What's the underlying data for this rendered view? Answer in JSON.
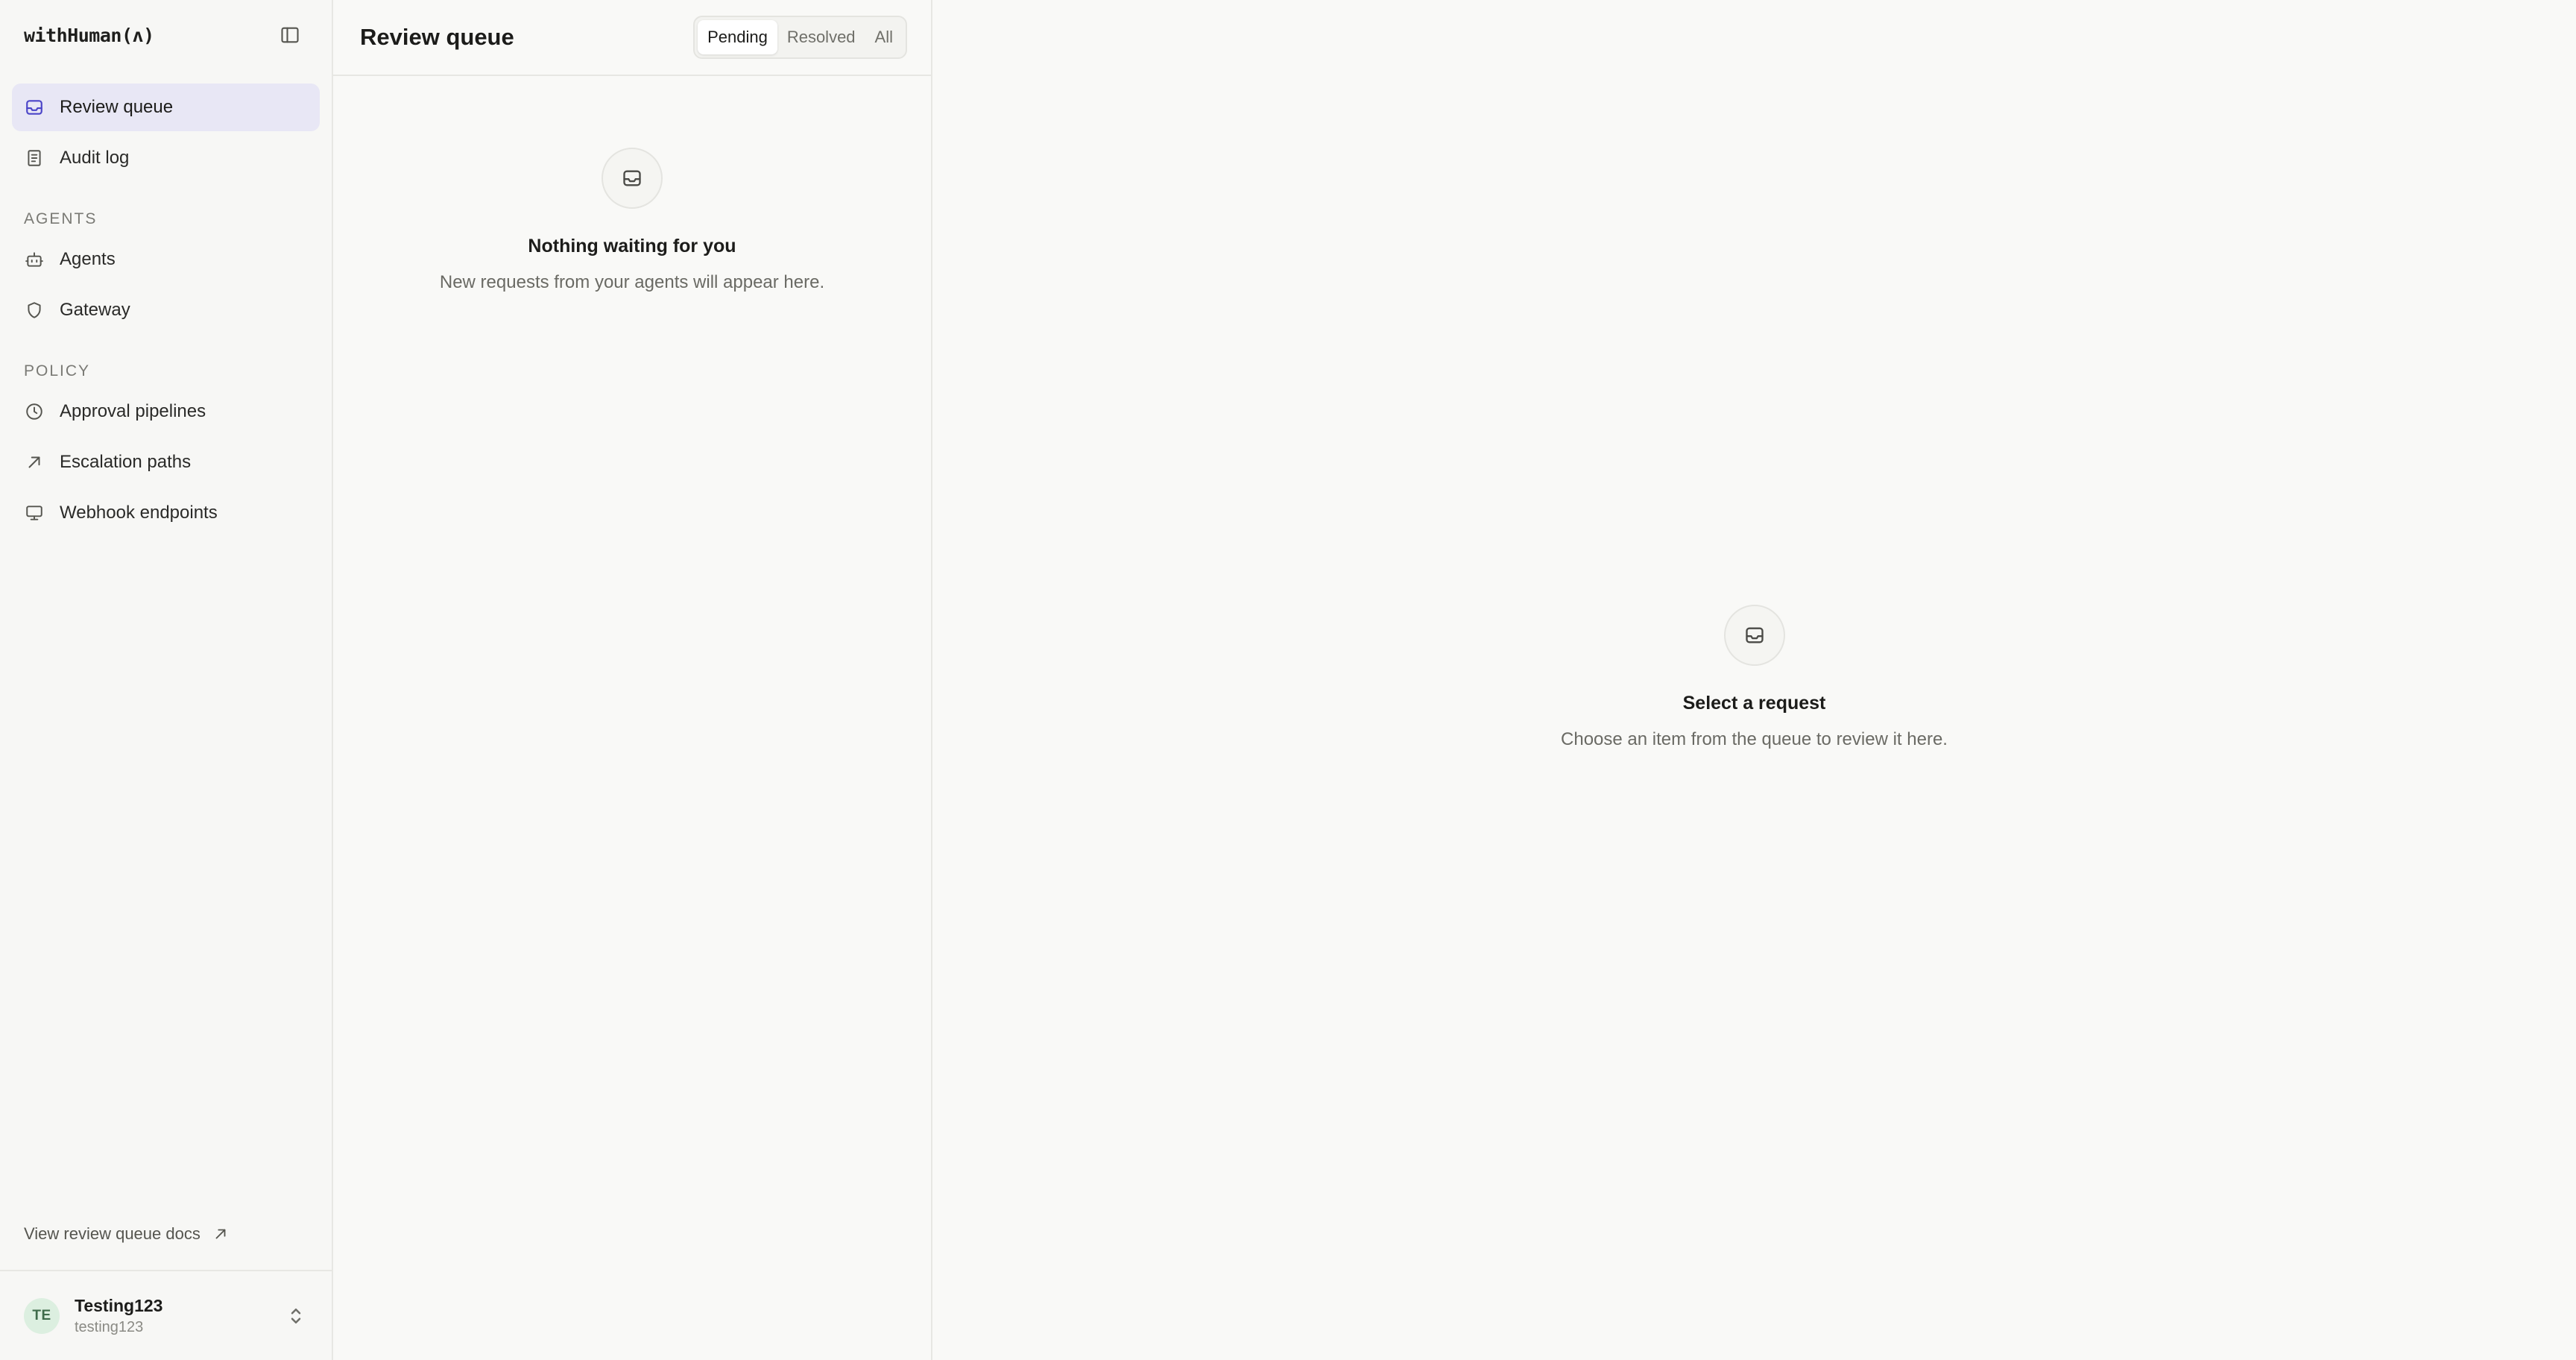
{
  "brand": {
    "name": "withHuman(ʌ)"
  },
  "sidebar": {
    "primary": [
      {
        "label": "Review queue",
        "icon": "inbox-icon",
        "active": true
      },
      {
        "label": "Audit log",
        "icon": "document-icon",
        "active": false
      }
    ],
    "sections": [
      {
        "title": "AGENTS",
        "items": [
          {
            "label": "Agents",
            "icon": "bot-icon"
          },
          {
            "label": "Gateway",
            "icon": "shield-icon"
          }
        ]
      },
      {
        "title": "POLICY",
        "items": [
          {
            "label": "Approval pipelines",
            "icon": "clock-icon"
          },
          {
            "label": "Escalation paths",
            "icon": "arrow-up-right-icon"
          },
          {
            "label": "Webhook endpoints",
            "icon": "monitor-icon"
          }
        ]
      }
    ],
    "docs_link": "View review queue docs",
    "user": {
      "initials": "TE",
      "name": "Testing123",
      "handle": "testing123"
    }
  },
  "queue": {
    "title": "Review queue",
    "filters": [
      {
        "label": "Pending",
        "active": true
      },
      {
        "label": "Resolved",
        "active": false
      },
      {
        "label": "All",
        "active": false
      }
    ],
    "empty_title": "Nothing waiting for you",
    "empty_subtitle": "New requests from your agents will appear here."
  },
  "detail": {
    "empty_title": "Select a request",
    "empty_subtitle": "Choose an item from the queue to review it here."
  },
  "colors": {
    "active_nav_bg": "#e8e7f5",
    "accent": "#4b45c8",
    "avatar_bg": "#dcefe0"
  }
}
